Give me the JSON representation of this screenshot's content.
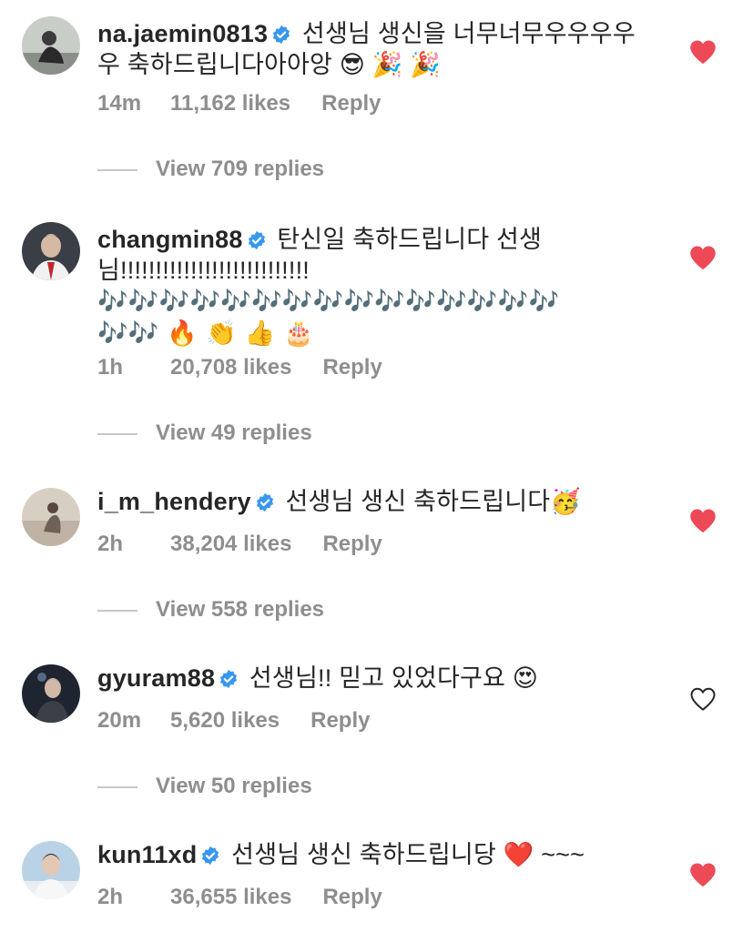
{
  "colors": {
    "text": "#262626",
    "muted": "#8e8e8e",
    "liked_heart": "#ed4956",
    "verified": "#3897f0"
  },
  "comments": [
    {
      "username": "na.jaemin0813",
      "text_line1": "선생님 생신을 너무너무우우우우",
      "text_line2": "우 축하드립니다아아앙 😎 🎉 🎉",
      "time": "14m",
      "likes": "11,162 likes",
      "reply": "Reply",
      "liked": true,
      "view_replies": "View 709 replies"
    },
    {
      "username": "changmin88",
      "text_line1": "탄신일 축하드립니다 선생",
      "text_line2": "님!!!!!!!!!!!!!!!!!!!!!!!!!!!",
      "text_line3": "🎶🎶🎶🎶🎶🎶🎶🎶🎶🎶🎶🎶🎶🎶🎶",
      "text_line4": "🎶🎶 🔥 👏 👍 🎂",
      "time": "1h",
      "likes": "20,708 likes",
      "reply": "Reply",
      "liked": true,
      "view_replies": "View 49 replies"
    },
    {
      "username": "i_m_hendery",
      "text_line1": "선생님 생신 축하드립니다🥳",
      "time": "2h",
      "likes": "38,204 likes",
      "reply": "Reply",
      "liked": true,
      "view_replies": "View 558 replies"
    },
    {
      "username": "gyuram88",
      "text_line1": "선생님!! 믿고 있었다구요 😍",
      "time": "20m",
      "likes": "5,620 likes",
      "reply": "Reply",
      "liked": false,
      "view_replies": "View 50 replies"
    },
    {
      "username": "kun11xd",
      "text_line1": "선생님 생신 축하드립니당 ❤️ ~~~",
      "time": "2h",
      "likes": "36,655 likes",
      "reply": "Reply",
      "liked": true
    }
  ]
}
